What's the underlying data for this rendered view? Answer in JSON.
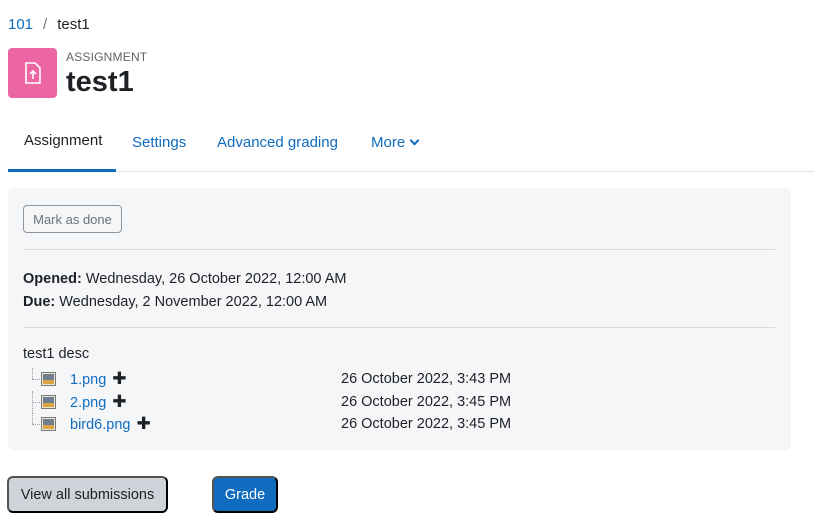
{
  "breadcrumb": {
    "course": "101",
    "separator": "/",
    "current": "test1"
  },
  "header": {
    "activity_type": "ASSIGNMENT",
    "title": "test1",
    "icon": "file-upload-icon",
    "icon_color": "#eb66a2"
  },
  "tabs": [
    {
      "label": "Assignment",
      "active": true
    },
    {
      "label": "Settings",
      "active": false
    },
    {
      "label": "Advanced grading",
      "active": false
    },
    {
      "label": "More",
      "active": false,
      "dropdown": true
    }
  ],
  "completion": {
    "mark_done_label": "Mark as done"
  },
  "dates": {
    "opened_label": "Opened:",
    "opened_value": " Wednesday, 26 October 2022, 12:00 AM",
    "due_label": "Due:",
    "due_value": " Wednesday, 2 November 2022, 12:00 AM"
  },
  "description": "test1 desc",
  "files": [
    {
      "name": "1.png",
      "date": "26 October 2022, 3:43 PM"
    },
    {
      "name": "2.png",
      "date": "26 October 2022, 3:45 PM"
    },
    {
      "name": "bird6.png",
      "date": "26 October 2022, 3:45 PM"
    }
  ],
  "actions": {
    "view_all_label": "View all submissions",
    "grade_label": "Grade"
  },
  "colors": {
    "link": "#0f6cbf",
    "primary": "#0f6cbf",
    "secondary": "#ced4da",
    "panel": "#f5f6f8"
  }
}
